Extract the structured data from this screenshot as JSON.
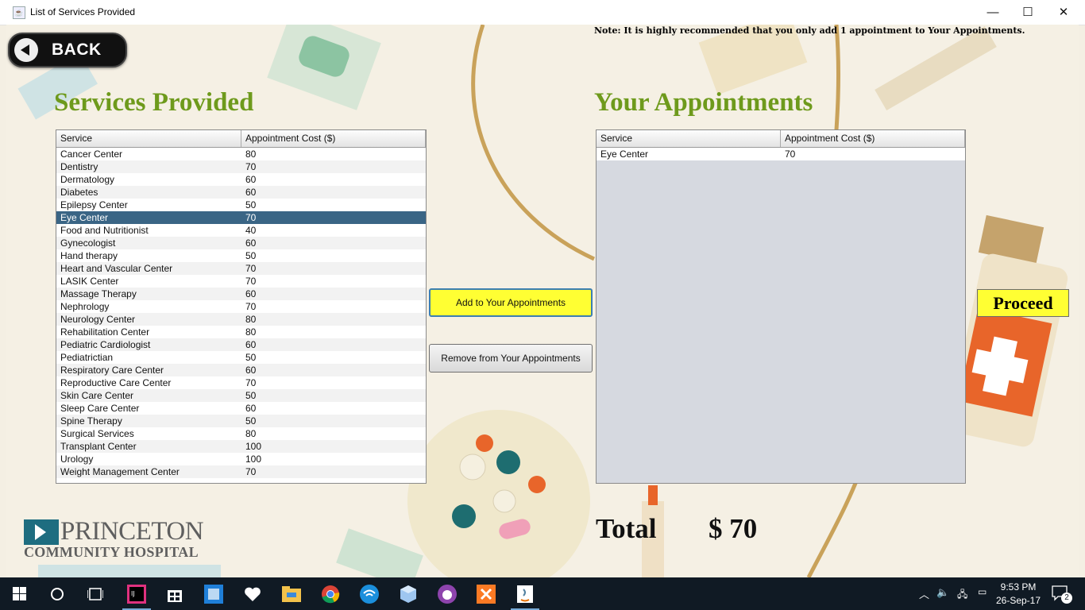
{
  "window": {
    "title": "List of Services Provided",
    "minimize": "—",
    "maximize": "☐",
    "close": "✕"
  },
  "back_label": "BACK",
  "note": "Note: It is highly recommended that you only add 1 appointment to Your Appointments.",
  "left_heading": "Services Provided",
  "right_heading": "Your Appointments",
  "columns": [
    "Service",
    "Appointment Cost ($)"
  ],
  "services": [
    {
      "name": "Cancer Center",
      "cost": "80"
    },
    {
      "name": "Dentistry",
      "cost": "70"
    },
    {
      "name": "Dermatology",
      "cost": "60"
    },
    {
      "name": "Diabetes",
      "cost": "60"
    },
    {
      "name": "Epilepsy Center",
      "cost": "50"
    },
    {
      "name": "Eye Center",
      "cost": "70"
    },
    {
      "name": "Food and Nutritionist",
      "cost": "40"
    },
    {
      "name": "Gynecologist",
      "cost": "60"
    },
    {
      "name": "Hand therapy",
      "cost": "50"
    },
    {
      "name": "Heart and Vascular Center",
      "cost": "70"
    },
    {
      "name": "LASIK Center",
      "cost": "70"
    },
    {
      "name": "Massage Therapy",
      "cost": "60"
    },
    {
      "name": "Nephrology",
      "cost": "70"
    },
    {
      "name": "Neurology Center",
      "cost": "80"
    },
    {
      "name": "Rehabilitation Center",
      "cost": "80"
    },
    {
      "name": "Pediatric Cardiologist",
      "cost": "60"
    },
    {
      "name": "Pediatrictian",
      "cost": "50"
    },
    {
      "name": "Respiratory Care Center",
      "cost": "60"
    },
    {
      "name": "Reproductive Care Center",
      "cost": "70"
    },
    {
      "name": "Skin Care Center",
      "cost": "50"
    },
    {
      "name": "Sleep Care Center",
      "cost": "60"
    },
    {
      "name": "Spine Therapy",
      "cost": "50"
    },
    {
      "name": "Surgical Services",
      "cost": "80"
    },
    {
      "name": "Transplant Center",
      "cost": "100"
    },
    {
      "name": "Urology",
      "cost": "100"
    },
    {
      "name": "Weight Management Center",
      "cost": "70"
    }
  ],
  "selected_service": "Eye Center",
  "appointments": [
    {
      "name": "Eye Center",
      "cost": "70"
    }
  ],
  "buttons": {
    "add": "Add to Your Appointments",
    "remove": "Remove from Your Appointments",
    "proceed": "Proceed"
  },
  "total": {
    "label": "Total",
    "value": "$ 70"
  },
  "logo": {
    "line1": "PRINCETON",
    "line2": "COMMUNITY HOSPITAL"
  },
  "taskbar": {
    "apps": [
      "windows-start",
      "cortana-search",
      "task-view",
      "intellij",
      "store",
      "app-blue",
      "iheartradio",
      "file-explorer",
      "chrome",
      "wifi-app",
      "virtualbox",
      "app-purple",
      "xampp",
      "java"
    ],
    "clock_time": "9:53 PM",
    "clock_date": "26-Sep-17",
    "notification_count": "2"
  },
  "colors": {
    "heading_green": "#6e9a1c",
    "selected_row": "#3a6585",
    "button_yellow": "#ffff33",
    "taskbar": "#101a24"
  }
}
